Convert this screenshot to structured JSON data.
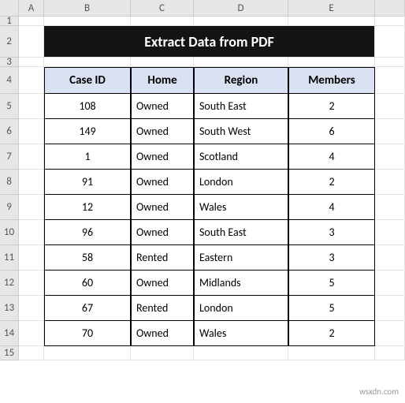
{
  "columns": [
    "A",
    "B",
    "C",
    "D",
    "E"
  ],
  "row_nums": [
    "1",
    "2",
    "3",
    "4",
    "5",
    "6",
    "7",
    "8",
    "9",
    "10",
    "11",
    "12",
    "13",
    "14",
    "15"
  ],
  "title": "Extract Data from PDF",
  "headers": {
    "case_id": "Case ID",
    "home": "Home",
    "region": "Region",
    "members": "Members"
  },
  "rows": [
    {
      "case_id": "108",
      "home": "Owned",
      "region": "South East",
      "members": "2"
    },
    {
      "case_id": "149",
      "home": "Owned",
      "region": "South West",
      "members": "6"
    },
    {
      "case_id": "1",
      "home": "Owned",
      "region": "Scotland",
      "members": "4"
    },
    {
      "case_id": "91",
      "home": "Owned",
      "region": "London",
      "members": "2"
    },
    {
      "case_id": "12",
      "home": "Owned",
      "region": "Wales",
      "members": "4"
    },
    {
      "case_id": "96",
      "home": "Owned",
      "region": "South East",
      "members": "3"
    },
    {
      "case_id": "58",
      "home": "Rented",
      "region": "Eastern",
      "members": "3"
    },
    {
      "case_id": "60",
      "home": "Owned",
      "region": "Midlands",
      "members": "5"
    },
    {
      "case_id": "67",
      "home": "Rented",
      "region": "London",
      "members": "5"
    },
    {
      "case_id": "70",
      "home": "Owned",
      "region": "Wales",
      "members": "2"
    }
  ],
  "watermark": "wsxdn.com"
}
